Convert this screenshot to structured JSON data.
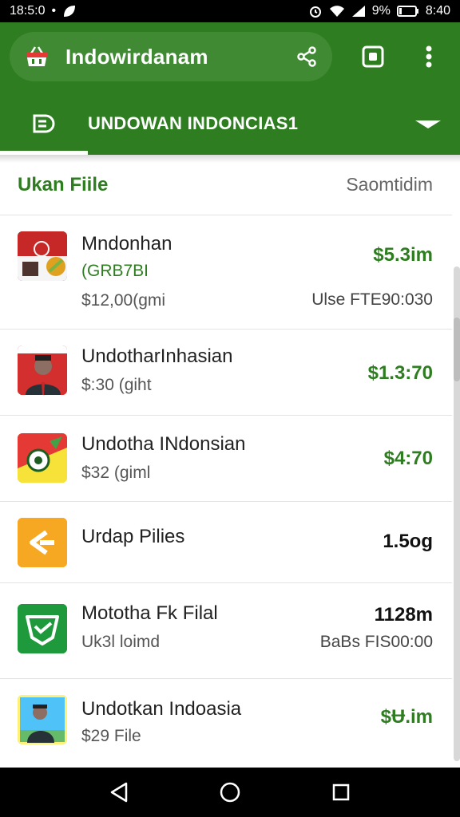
{
  "status_bar": {
    "time_left": "18:5:0",
    "battery": "9%",
    "time_right": "8:40"
  },
  "header": {
    "title": "Indowirdanam",
    "tab_label": "UNDOWAN INDONCIAS1"
  },
  "list": {
    "title": "Ukan Fiile",
    "sort_label": "Saomtidim",
    "items": [
      {
        "name": "Mndonhan",
        "code": "(GRB7BI",
        "sub": "$12,00(gmi",
        "price": "$5.3im",
        "meta": "Ulse FTE90:030"
      },
      {
        "name": "UndotharInhasian",
        "sub": "$:30 (giht",
        "price": "$1.3:70"
      },
      {
        "name": "Undotha INdonsian",
        "sub": "$32 (giml",
        "price": "$4:70"
      },
      {
        "name": "Urdap Pilies",
        "price": "1.5og"
      },
      {
        "name": "Mototha Fk Filal",
        "sub": "Uk3l loimd",
        "price": "1128m",
        "meta": "BaBs FIS00:00"
      },
      {
        "name": "Undotkan Indoasia",
        "sub": "$29 File",
        "price": "$Ʉ.im"
      }
    ]
  },
  "colors": {
    "brand_green": "#2e7d20",
    "price_green": "#2e7d20",
    "thumb_orange": "#f7a823",
    "thumb_green": "#1e9a3c"
  },
  "icons": [
    "basket-icon",
    "share-icon",
    "square-icon",
    "more-vert-icon",
    "tab-list-icon",
    "dropdown-icon",
    "back-icon",
    "home-icon",
    "recents-icon"
  ]
}
